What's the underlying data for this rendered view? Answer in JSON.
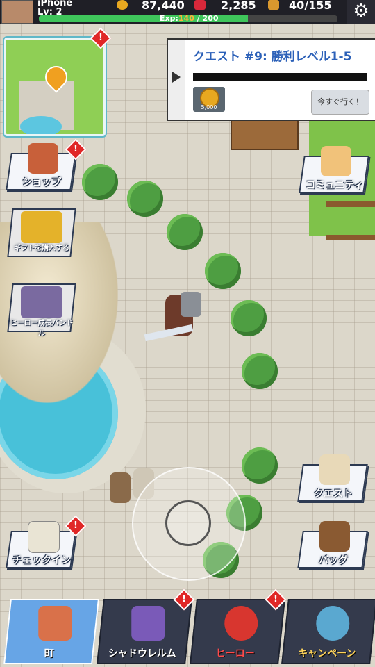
{
  "player": {
    "name": "iPhone",
    "level": "Lv: 2",
    "exp_label": "Exp:",
    "exp_current": "140",
    "exp_sep": " / ",
    "exp_max": "200",
    "exp_fraction": 0.7
  },
  "resources": {
    "gold": "87,440",
    "gems": "2,285",
    "stamina": "40/155"
  },
  "quest": {
    "title": "クエスト #9: 勝利レベル1-5",
    "reward_amount": "5,000",
    "go_label": "今すぐ行く！"
  },
  "side_left": [
    {
      "label": "ショップ",
      "alert": "!"
    },
    {
      "label": "ギフトを購入する"
    },
    {
      "label": "ヒーロー成長バンドル"
    },
    {
      "label": "チェックイン",
      "alert": "!"
    }
  ],
  "side_right": [
    {
      "label": "コミュニティ"
    },
    {
      "label": "クエスト"
    },
    {
      "label": "バッグ"
    }
  ],
  "minimap_alert": "!",
  "nav": [
    {
      "label": "町",
      "active": true
    },
    {
      "label": "シャドウレルム",
      "alert": "!"
    },
    {
      "label": "ヒーロー",
      "alert": "!"
    },
    {
      "label": "キャンペーン"
    }
  ],
  "colors": {
    "accent": "#67a5e6",
    "exp_fill": "#3fc55b",
    "alert": "#e02727",
    "quest_title": "#2b60b8"
  }
}
